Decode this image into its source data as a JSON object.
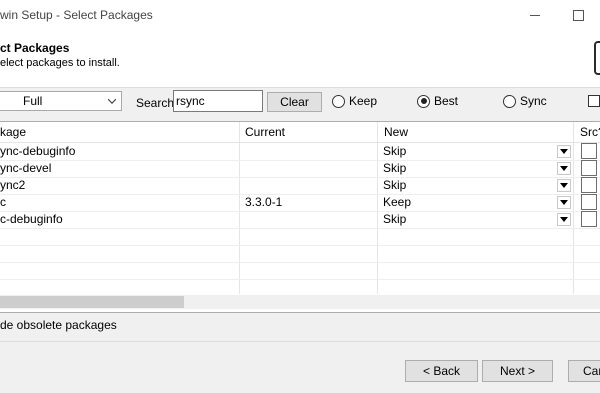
{
  "window": {
    "title": "win Setup - Select Packages"
  },
  "header": {
    "title": "ct Packages",
    "subtitle": "elect packages to install."
  },
  "toolbar": {
    "view_value": "Full",
    "search_label": "Search",
    "search_value": "rsync",
    "clear_label": "Clear",
    "radios": {
      "keep": "Keep",
      "best": "Best",
      "sync": "Sync"
    },
    "selected_radio": "Best"
  },
  "table": {
    "columns": {
      "package": "kage",
      "current": "Current",
      "new": "New",
      "src": "Src?"
    },
    "rows": [
      {
        "package": "ync-debuginfo",
        "current": "",
        "new": "Skip"
      },
      {
        "package": "ync-devel",
        "current": "",
        "new": "Skip"
      },
      {
        "package": "ync2",
        "current": "",
        "new": "Skip"
      },
      {
        "package": "c",
        "current": "3.3.0-1",
        "new": "Keep"
      },
      {
        "package": "c-debuginfo",
        "current": "",
        "new": "Skip"
      }
    ]
  },
  "options": {
    "hide_obsolete_label": "de obsolete packages"
  },
  "footer": {
    "back_label": "< Back",
    "next_label": "Next >",
    "cancel_label": "Car"
  },
  "colors": {
    "window_bg": "#f0f0f0",
    "table_bg": "#ffffff",
    "button_bg": "#e1e1e1"
  },
  "icons": {
    "minimize": "minimize-icon",
    "maximize": "maximize-icon",
    "dropdown": "chevron-down-icon"
  }
}
